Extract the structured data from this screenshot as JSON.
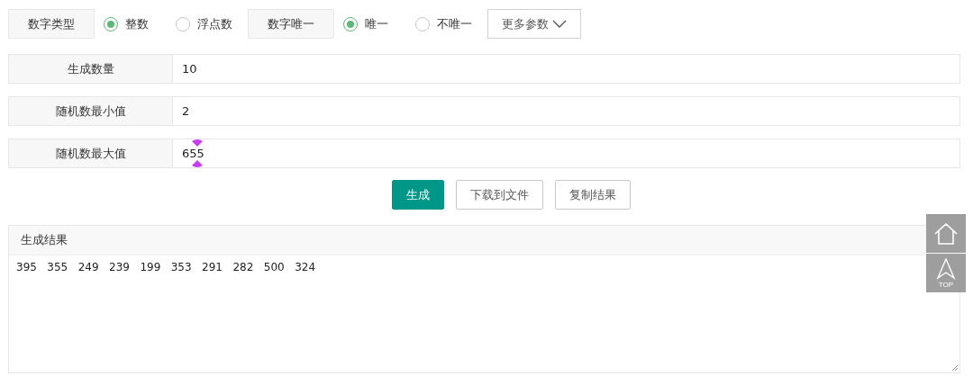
{
  "options": [
    {
      "kind": "radio-group",
      "label": "数字类型",
      "options": [
        {
          "label": "整数",
          "selected": true
        },
        {
          "label": "浮点数",
          "selected": false
        }
      ]
    },
    {
      "kind": "radio-group",
      "label": "数字唯一",
      "options": [
        {
          "label": "唯一",
          "selected": true
        },
        {
          "label": "不唯一",
          "selected": false
        }
      ]
    },
    {
      "kind": "dropdown",
      "label": "更多参数"
    }
  ],
  "fields": [
    {
      "label": "生成数量",
      "value": "10",
      "cursor": false
    },
    {
      "label": "随机数最小值",
      "value": "2",
      "cursor": false
    },
    {
      "label": "随机数最大值",
      "value": "655",
      "cursor": true
    }
  ],
  "buttons": [
    {
      "label": "生成",
      "primary": true
    },
    {
      "label": "下载到文件",
      "primary": false
    },
    {
      "label": "复制结果",
      "primary": false
    }
  ],
  "result": {
    "title": "生成结果",
    "text": "395   355   249   239   199   353   291   282   500   324"
  },
  "float_buttons": {
    "top_label": "TOP"
  }
}
